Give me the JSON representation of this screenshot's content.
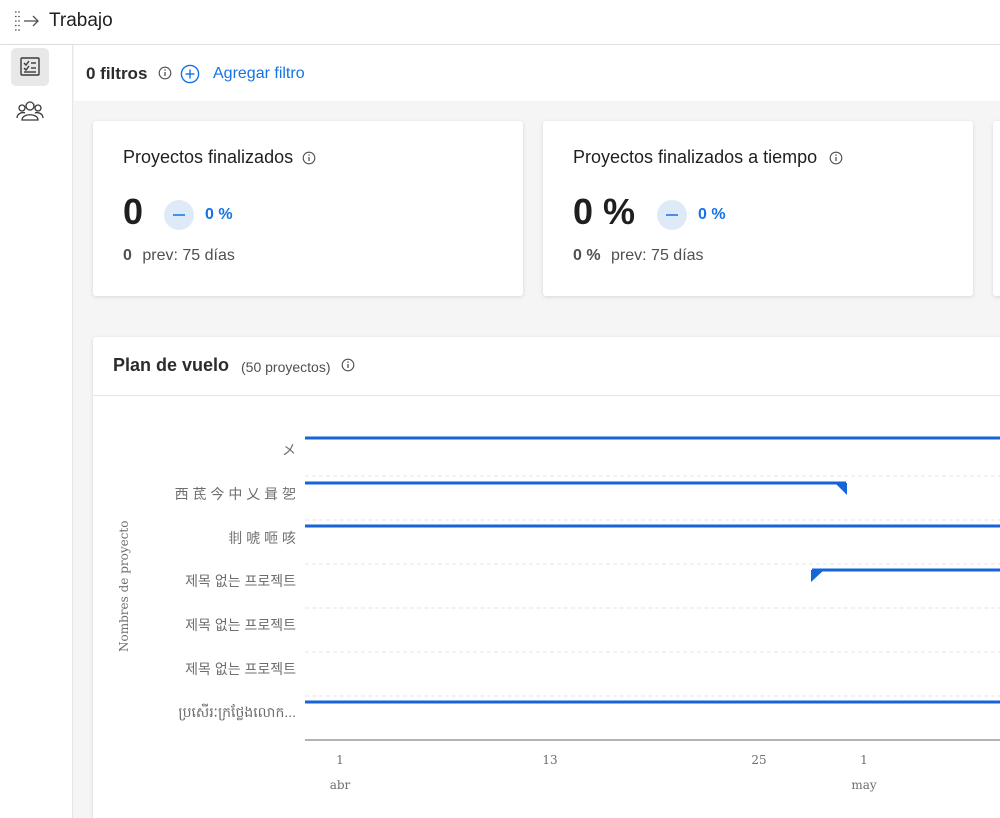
{
  "app": {
    "title": "Trabajo"
  },
  "filters": {
    "count_label": "0 filtros",
    "add_label": "Agregar filtro"
  },
  "cards": [
    {
      "title": "Proyectos finalizados",
      "value": "0",
      "trend": "0 %",
      "prev_value": "0",
      "prev_label": "prev: 75 días"
    },
    {
      "title": "Proyectos finalizados a tiempo",
      "value": "0 %",
      "trend": "0 %",
      "prev_value": "0 %",
      "prev_label": "prev: 75 días"
    }
  ],
  "flight_plan": {
    "title": "Plan de vuelo",
    "count": "(50  proyectos)",
    "y_axis_label": "Nombres de proyecto",
    "rows": [
      "メ",
      "西 茋 今 中 乂 咠 乫",
      "剕 唬 咂 咳",
      "제목 없는 프로젝트",
      "제목 없는 프로젝트",
      "제목 없는 프로젝트",
      "ប្រសើរៈក្រថ្លែងលោក..."
    ],
    "x_ticks": [
      "1",
      "13",
      "25",
      "1"
    ],
    "x_months": [
      "abr",
      "may"
    ]
  },
  "colors": {
    "accent": "#1473e6",
    "bar": "#1565d8"
  }
}
